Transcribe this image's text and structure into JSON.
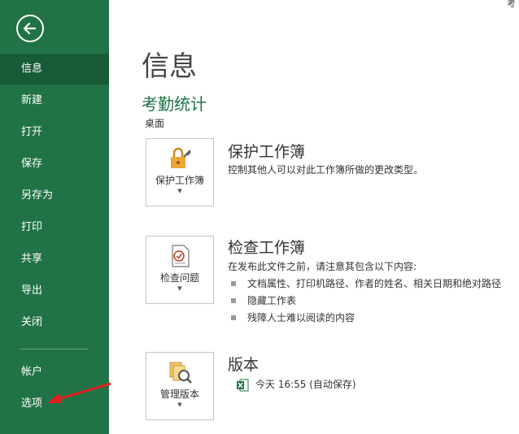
{
  "sidebar": {
    "items": [
      {
        "label": "信息",
        "active": true
      },
      {
        "label": "新建"
      },
      {
        "label": "打开"
      },
      {
        "label": "保存"
      },
      {
        "label": "另存为"
      },
      {
        "label": "打印"
      },
      {
        "label": "共享"
      },
      {
        "label": "导出"
      },
      {
        "label": "关闭"
      },
      {
        "label": "帐户"
      },
      {
        "label": "选项"
      }
    ]
  },
  "header": {
    "corner_text": "考"
  },
  "main": {
    "title": "信息",
    "doc_name": "考勤统计",
    "doc_location": "桌面",
    "protect": {
      "button_label": "保护工作簿",
      "title": "保护工作簿",
      "desc": "控制其他人可以对此工作簿所做的更改类型。"
    },
    "inspect": {
      "button_label": "检查问题",
      "title": "检查工作簿",
      "desc": "在发布此文件之前，请注意其包含以下内容:",
      "bullets": [
        "文档属性、打印机路径、作者的姓名、相关日期和绝对路径",
        "隐藏工作表",
        "残障人士难以阅读的内容"
      ]
    },
    "versions": {
      "button_label": "管理版本",
      "title": "版本",
      "entry": "今天 16:55 (自动保存)"
    }
  },
  "colors": {
    "sidebar": "#217346",
    "sidebar_active": "#185c37",
    "accent_text": "#217346",
    "annotation_arrow": "#e02020"
  }
}
